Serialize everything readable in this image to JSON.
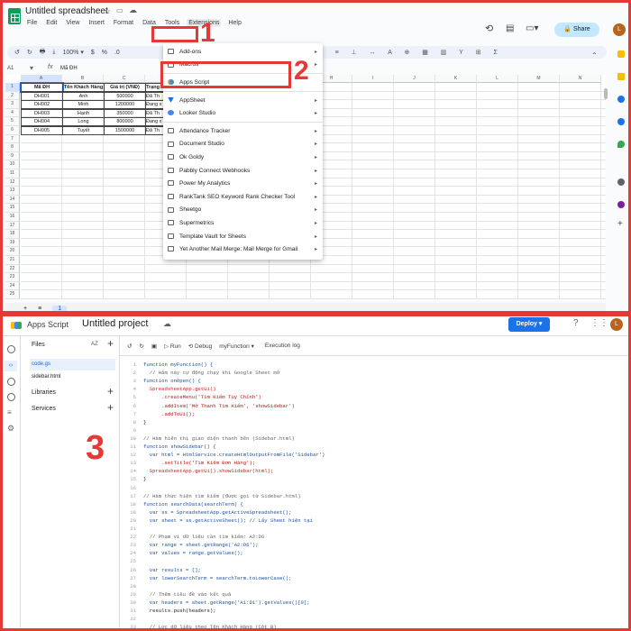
{
  "sheets": {
    "doc_title": "Untitled spreadsheet",
    "menu": [
      "File",
      "Edit",
      "View",
      "Insert",
      "Format",
      "Data",
      "Tools",
      "Extensions",
      "Help"
    ],
    "toolbar": [
      "↺",
      "↻",
      "🖶",
      "⤓",
      "100% ▾",
      "$",
      "%",
      ".0"
    ],
    "name_box": "A1",
    "formula": "Mã ĐH",
    "share_label": "Share",
    "avatar_letter": "L",
    "columns": [
      "A",
      "B",
      "C",
      "D",
      "E",
      "F",
      "G",
      "H",
      "I",
      "J",
      "K",
      "L",
      "M",
      "N"
    ],
    "rows": [
      "1",
      "2",
      "3",
      "4",
      "5",
      "6",
      "7",
      "8",
      "9",
      "10",
      "11",
      "12",
      "13",
      "14",
      "15",
      "16",
      "17",
      "18",
      "19",
      "20",
      "21",
      "22",
      "23",
      "24",
      "25"
    ],
    "table": {
      "headers": [
        "Mã ĐH",
        "Tên Khách Hàng",
        "Giá trị (VNĐ)",
        "Trạng"
      ],
      "rows": [
        [
          "DH001",
          "Anh",
          "500000",
          "Đã Th"
        ],
        [
          "DH002",
          "Minh",
          "1200000",
          "Đang x"
        ],
        [
          "DH003",
          "Hạnh",
          "350000",
          "Đã Th"
        ],
        [
          "DH004",
          "Long",
          "800000",
          "Đang x"
        ],
        [
          "DH005",
          "Tuyết",
          "1500000",
          "Đã Th"
        ]
      ]
    },
    "sheet_tab": "1",
    "add_sheet": "+",
    "all_sheets": "≡"
  },
  "ext_menu": {
    "items": [
      {
        "label": "Add-ons",
        "arrow": true
      },
      {
        "label": "Macros",
        "arrow": true
      },
      {
        "sep": true
      },
      {
        "label": "Apps Script",
        "arrow": false
      },
      {
        "sep": true
      },
      {
        "label": "AppSheet",
        "arrow": true
      },
      {
        "label": "Looker Studio",
        "arrow": true
      },
      {
        "sep": true
      },
      {
        "label": "Attendance Tracker",
        "arrow": true
      },
      {
        "label": "Document Studio",
        "arrow": true
      },
      {
        "label": "Ok Goldy",
        "arrow": true
      },
      {
        "label": "Pabbly Connect Webhooks",
        "arrow": true
      },
      {
        "label": "Power My Analytics",
        "arrow": true
      },
      {
        "label": "RankTank SEO Keyword Rank Checker Tool",
        "arrow": true
      },
      {
        "label": "Sheetgo",
        "arrow": true
      },
      {
        "label": "Supermetrics",
        "arrow": true
      },
      {
        "label": "Template Vault for Sheets",
        "arrow": true
      },
      {
        "label": "Yet Another Mail Merge: Mail Merge for Gmail",
        "arrow": true
      }
    ]
  },
  "annotations": {
    "n1": "1",
    "n2": "2",
    "n3": "3"
  },
  "apps_script": {
    "app_name": "Apps Script",
    "project": "Untitled project",
    "deploy": "Deploy",
    "avatar_letter": "L",
    "files_heading": "Files",
    "files_sort": "AZ",
    "files": [
      "code.gs",
      "sidebar.html"
    ],
    "libraries": "Libraries",
    "services": "Services",
    "run": "▷ Run",
    "debug": "⟲ Debug",
    "function_select": "myFunction ▾",
    "exec_log": "Execution log",
    "code_lines": [
      "function myFunction() {",
      "  // Hàm này tự động chạy khi Google Sheet mở",
      "function onOpen() {",
      "  SpreadsheetApp.getUi()",
      "      .createMenu('Tìm Kiếm Tùy Chỉnh')",
      "      .addItem('Mở Thanh Tìm Kiếm', 'showSidebar')",
      "      .addToUi();",
      "}",
      "",
      "// Hàm hiển thị giao diện thanh bên (Sidebar.html)",
      "function showSidebar() {",
      "  var html = HtmlService.createHtmlOutputFromFile('Sidebar')",
      "      .setTitle('Tìm Kiếm Đơn Hàng');",
      "  SpreadsheetApp.getUi().showSidebar(html);",
      "}",
      "",
      "// Hàm thực hiện tìm kiếm (được gọi từ Sidebar.html)",
      "function searchData(searchTerm) {",
      "  var ss = SpreadsheetApp.getActiveSpreadsheet();",
      "  var sheet = ss.getActiveSheet(); // Lấy Sheet hiện tại",
      "",
      "  // Phạm vi dữ liệu cần tìm kiếm: A2:D6",
      "  var range = sheet.getRange('A2:D6');",
      "  var values = range.getValues();",
      "",
      "  var results = [];",
      "  var lowerSearchTerm = searchTerm.toLowerCase();",
      "",
      "  // Thêm tiêu đề vào kết quả",
      "  var headers = sheet.getRange('A1:D1').getValues()[0];",
      "  results.push(headers);",
      "",
      "  // Lọc dữ liệu theo Tên Khách Hàng (Cột B)"
    ],
    "line_numbers": [
      "1",
      "2",
      "3",
      "4",
      "5",
      "6",
      "7",
      "8",
      "9",
      "10",
      "11",
      "12",
      "13",
      "14",
      "15",
      "16",
      "17",
      "18",
      "19",
      "20",
      "21",
      "22",
      "23",
      "24",
      "25",
      "26",
      "27",
      "28",
      "29",
      "30",
      "31",
      "32",
      "33"
    ]
  }
}
